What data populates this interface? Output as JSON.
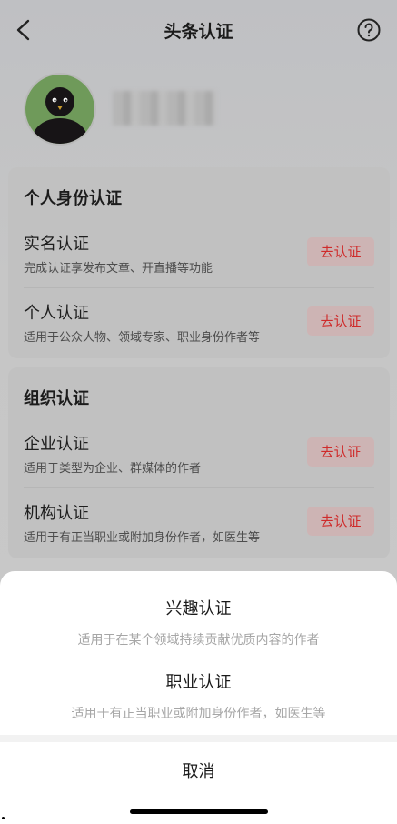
{
  "nav": {
    "title": "头条认证",
    "back_icon": "chevron-left-icon",
    "help_icon": "question-circle-icon"
  },
  "profile": {
    "avatar": "penguin-avatar"
  },
  "personal": {
    "heading": "个人身份认证",
    "items": [
      {
        "name": "实名认证",
        "desc": "完成认证享发布文章、开直播等功能",
        "button": "去认证"
      },
      {
        "name": "个人认证",
        "desc": "适用于公众人物、领域专家、职业身份作者等",
        "button": "去认证"
      }
    ]
  },
  "organization": {
    "heading": "组织认证",
    "items": [
      {
        "name": "企业认证",
        "desc": "适用于类型为企业、群媒体的作者",
        "button": "去认证"
      },
      {
        "name": "机构认证",
        "desc": "适用于有正当职业或附加身份作者，如医生等",
        "button": "去认证"
      }
    ]
  },
  "sheet": {
    "options": [
      {
        "title": "兴趣认证",
        "subtitle": "适用于在某个领域持续贡献优质内容的作者"
      },
      {
        "title": "职业认证",
        "subtitle": "适用于有正当职业或附加身份作者，如医生等"
      }
    ],
    "cancel": "取消"
  },
  "colors": {
    "accent_red": "#cf2b2b",
    "overlay": "#c9c9c9",
    "sheet_bg": "#ffffff"
  }
}
